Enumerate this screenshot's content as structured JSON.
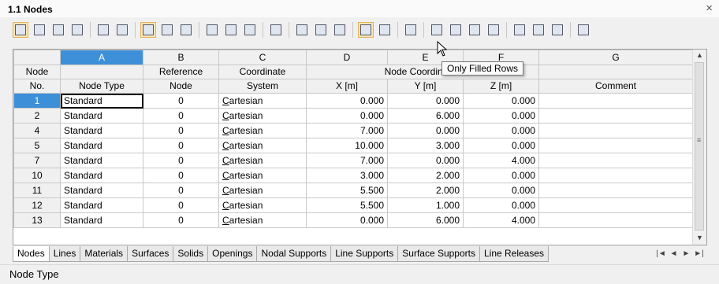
{
  "window": {
    "title": "1.1 Nodes",
    "close_label": "×"
  },
  "toolbar": {
    "buttons": [
      "table-view-icon",
      "insert-row-icon",
      "delete-row-icon",
      "clear-icon",
      "import-icon",
      "export-icon",
      "hand-icon",
      "pick-icon",
      "sync-icon",
      "cut-icon",
      "copy-icon",
      "paste-icon",
      "clear-cells-icon",
      "mark-delete-icon",
      "row-up-icon",
      "row-down-icon",
      "only-filled-rows-icon",
      "all-rows-icon",
      "edit-icon",
      "graphics-icon",
      "glasses-icon",
      "excel-icon",
      "calculator-icon",
      "text-icon",
      "fx-icon",
      "fx-strike-icon",
      "lock-icon"
    ],
    "active": [
      "table-view-icon",
      "hand-icon",
      "only-filled-rows-icon"
    ]
  },
  "tooltip": {
    "text": "Only Filled Rows"
  },
  "table": {
    "column_letters": [
      "A",
      "B",
      "C",
      "D",
      "E",
      "F",
      "G"
    ],
    "header_row1": {
      "node": "Node",
      "ref": "Reference",
      "coord_sys": "Coordinate",
      "coords": "Node Coordinates"
    },
    "header_row2": {
      "node": "No.",
      "type": "Node Type",
      "ref": "Node",
      "coord_sys": "System",
      "x": "X [m]",
      "y": "Y [m]",
      "z": "Z [m]",
      "comment": "Comment"
    },
    "rows": [
      {
        "no": "1",
        "type": "Standard",
        "ref": "0",
        "sys": "Cartesian",
        "x": "0.000",
        "y": "0.000",
        "z": "0.000",
        "comment": ""
      },
      {
        "no": "2",
        "type": "Standard",
        "ref": "0",
        "sys": "Cartesian",
        "x": "0.000",
        "y": "6.000",
        "z": "0.000",
        "comment": ""
      },
      {
        "no": "4",
        "type": "Standard",
        "ref": "0",
        "sys": "Cartesian",
        "x": "7.000",
        "y": "0.000",
        "z": "0.000",
        "comment": ""
      },
      {
        "no": "5",
        "type": "Standard",
        "ref": "0",
        "sys": "Cartesian",
        "x": "10.000",
        "y": "3.000",
        "z": "0.000",
        "comment": ""
      },
      {
        "no": "7",
        "type": "Standard",
        "ref": "0",
        "sys": "Cartesian",
        "x": "7.000",
        "y": "0.000",
        "z": "4.000",
        "comment": ""
      },
      {
        "no": "10",
        "type": "Standard",
        "ref": "0",
        "sys": "Cartesian",
        "x": "3.000",
        "y": "2.000",
        "z": "0.000",
        "comment": ""
      },
      {
        "no": "11",
        "type": "Standard",
        "ref": "0",
        "sys": "Cartesian",
        "x": "5.500",
        "y": "2.000",
        "z": "0.000",
        "comment": ""
      },
      {
        "no": "12",
        "type": "Standard",
        "ref": "0",
        "sys": "Cartesian",
        "x": "5.500",
        "y": "1.000",
        "z": "0.000",
        "comment": ""
      },
      {
        "no": "13",
        "type": "Standard",
        "ref": "0",
        "sys": "Cartesian",
        "x": "0.000",
        "y": "6.000",
        "z": "4.000",
        "comment": ""
      }
    ]
  },
  "tabs": [
    "Nodes",
    "Lines",
    "Materials",
    "Surfaces",
    "Solids",
    "Openings",
    "Nodal Supports",
    "Line Supports",
    "Surface Supports",
    "Line Releases"
  ],
  "active_tab": "Nodes",
  "status": {
    "text": "Node Type"
  },
  "colors": {
    "selection": "#3d8fd8",
    "active_button": "#fbe7b5",
    "header": "#f0f0f0"
  }
}
